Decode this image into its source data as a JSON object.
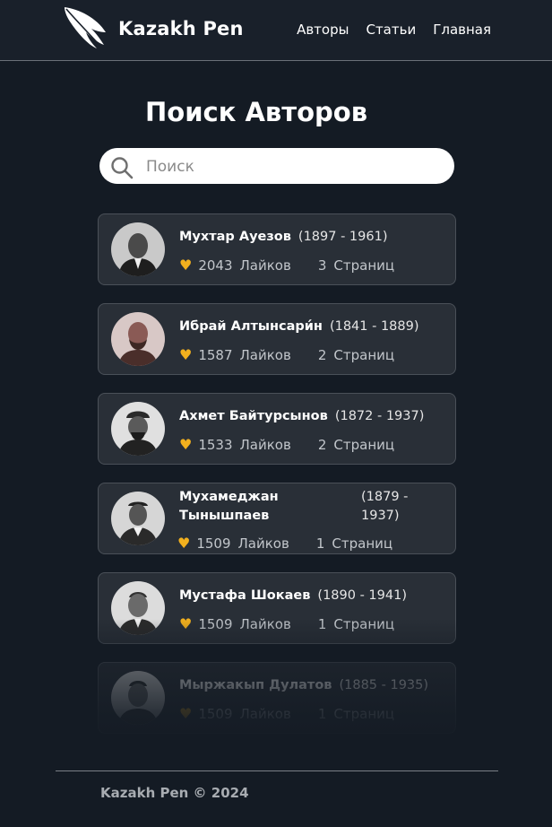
{
  "header": {
    "brand": "Kazakh Pen",
    "logo_icon": "feather-icon",
    "nav": [
      "Авторы",
      "Статьи",
      "Главная"
    ]
  },
  "main": {
    "title": "Поиск Авторов",
    "search": {
      "placeholder": "Поиск",
      "value": "",
      "icon": "search-icon"
    }
  },
  "authors": [
    {
      "name": "Мухтар Ауезов",
      "years": "(1897 - 1961)",
      "likes": "2043",
      "likes_label": "Лайков",
      "pages": "3",
      "pages_label": "Страниц",
      "avatar_icon": "portrait-icon"
    },
    {
      "name": "Ибрай Алтынсари́н",
      "years": "(1841 - 1889)",
      "likes": "1587",
      "likes_label": "Лайков",
      "pages": "2",
      "pages_label": "Страниц",
      "avatar_icon": "portrait-icon"
    },
    {
      "name": "Ахмет Байтурсынов",
      "years": "(1872 - 1937)",
      "likes": "1533",
      "likes_label": "Лайков",
      "pages": "2",
      "pages_label": "Страниц",
      "avatar_icon": "portrait-icon"
    },
    {
      "name": "Мухамеджан Тынышпаев",
      "years": "(1879 - 1937)",
      "likes": "1509",
      "likes_label": "Лайков",
      "pages": "1",
      "pages_label": "Страниц",
      "avatar_icon": "portrait-icon"
    },
    {
      "name": "Мустафа Шокаев",
      "years": "(1890 - 1941)",
      "likes": "1509",
      "likes_label": "Лайков",
      "pages": "1",
      "pages_label": "Страниц",
      "avatar_icon": "portrait-icon"
    },
    {
      "name": "Мыржакып Дулатов",
      "years": "(1885 - 1935)",
      "likes": "1509",
      "likes_label": "Лайков",
      "pages": "1",
      "pages_label": "Страниц",
      "avatar_icon": "portrait-icon"
    }
  ],
  "footer": {
    "text": "Kazakh Pen © 2024"
  },
  "colors": {
    "background": "#141b24",
    "card": "#292f37",
    "heart": "#f2b01e"
  }
}
